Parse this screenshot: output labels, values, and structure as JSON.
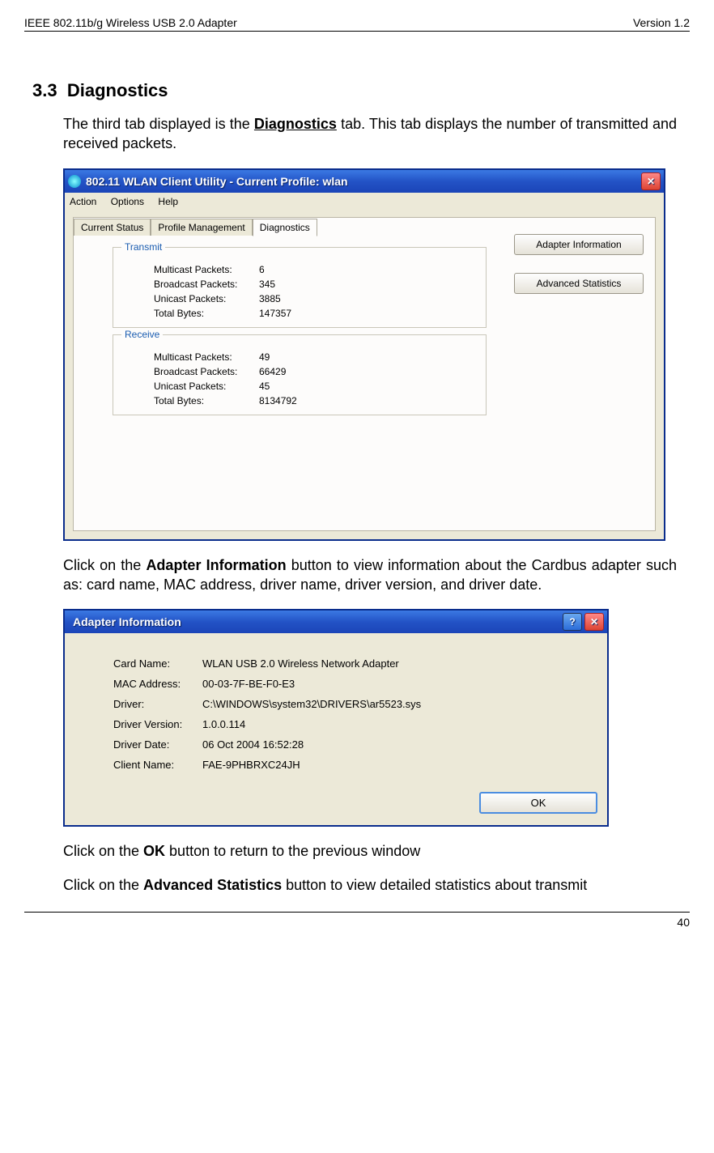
{
  "header": {
    "left": "IEEE 802.11b/g Wireless USB 2.0 Adapter",
    "right": "Version 1.2"
  },
  "section": {
    "num": "3.3",
    "title": "Diagnostics"
  },
  "para1a": "The third tab displayed is the ",
  "para1b": "Diagnostics",
  "para1c": " tab. This tab displays the number of transmitted and received packets.",
  "win1": {
    "title": "802.11 WLAN Client Utility - Current Profile: wlan",
    "menu": {
      "m1": "Action",
      "m2": "Options",
      "m3": "Help"
    },
    "tabs": {
      "t1": "Current Status",
      "t2": "Profile Management",
      "t3": "Diagnostics"
    },
    "transmit": {
      "legend": "Transmit",
      "multicast_l": "Multicast Packets:",
      "multicast_v": "6",
      "broadcast_l": "Broadcast Packets:",
      "broadcast_v": "345",
      "unicast_l": "Unicast Packets:",
      "unicast_v": "3885",
      "total_l": "Total Bytes:",
      "total_v": "147357"
    },
    "receive": {
      "legend": "Receive",
      "multicast_l": "Multicast Packets:",
      "multicast_v": "49",
      "broadcast_l": "Broadcast Packets:",
      "broadcast_v": "66429",
      "unicast_l": "Unicast Packets:",
      "unicast_v": "45",
      "total_l": "Total Bytes:",
      "total_v": "8134792"
    },
    "btn1": "Adapter Information",
    "btn2": "Advanced Statistics"
  },
  "para2a": "Click on the ",
  "para2b": "Adapter Information",
  "para2c": " button to view information about the Cardbus adapter such as: card name, MAC address, driver name, driver version, and driver date.",
  "win2": {
    "title": "Adapter Information",
    "card_l": "Card Name:",
    "card_v": "WLAN USB 2.0 Wireless Network Adapter",
    "mac_l": "MAC Address:",
    "mac_v": "00-03-7F-BE-F0-E3",
    "driver_l": "Driver:",
    "driver_v": "C:\\WINDOWS\\system32\\DRIVERS\\ar5523.sys",
    "dver_l": "Driver Version:",
    "dver_v": "1.0.0.114",
    "ddate_l": "Driver Date:",
    "ddate_v": "06 Oct 2004 16:52:28",
    "client_l": "Client Name:",
    "client_v": "FAE-9PHBRXC24JH",
    "ok": "OK"
  },
  "para3a": "Click on the ",
  "para3b": "OK",
  "para3c": " button to return to the previous window",
  "para4a": "Click on the ",
  "para4b": "Advanced Statistics",
  "para4c": " button to view detailed statistics about transmit",
  "footer": {
    "page": "40"
  }
}
